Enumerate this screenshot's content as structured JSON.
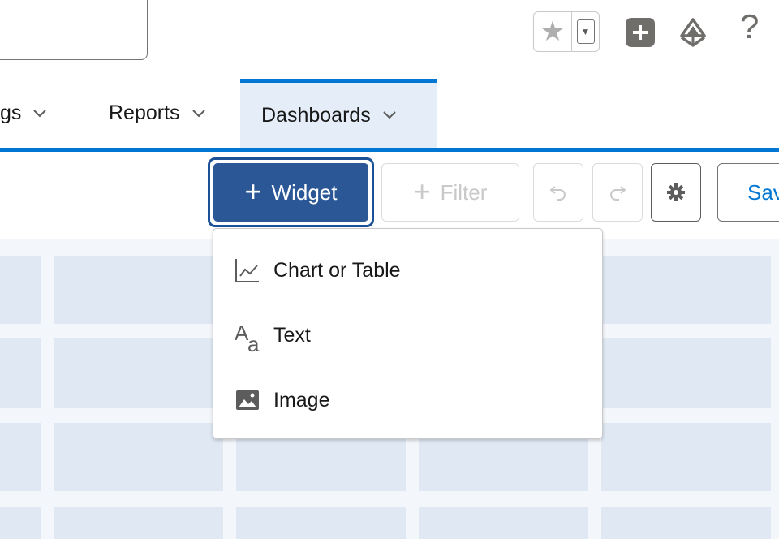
{
  "header": {
    "favorites_icon": "star-icon",
    "favorites_dropdown_icon": "caret-down-icon",
    "add_icon": "plus-square-icon",
    "trailhead_icon": "trailhead-icon",
    "help_label": "?"
  },
  "nav": {
    "tabs": [
      {
        "label": "gs",
        "active": false
      },
      {
        "label": "Reports",
        "active": false
      },
      {
        "label": "Dashboards",
        "active": true
      }
    ],
    "accent_color": "#0176d3"
  },
  "toolbar": {
    "widget_label": "Widget",
    "filter_label": "Filter",
    "undo_icon": "undo-icon",
    "redo_icon": "redo-icon",
    "settings_icon": "gear-icon",
    "save_label": "Sav"
  },
  "widget_menu": {
    "items": [
      {
        "label": "Chart or Table",
        "icon": "chart-icon"
      },
      {
        "label": "Text",
        "icon": "text-icon"
      },
      {
        "label": "Image",
        "icon": "image-icon"
      }
    ]
  },
  "colors": {
    "primary_button": "#2b5797",
    "canvas_background": "#f3f6fa",
    "canvas_cell": "#dfe8f3"
  }
}
